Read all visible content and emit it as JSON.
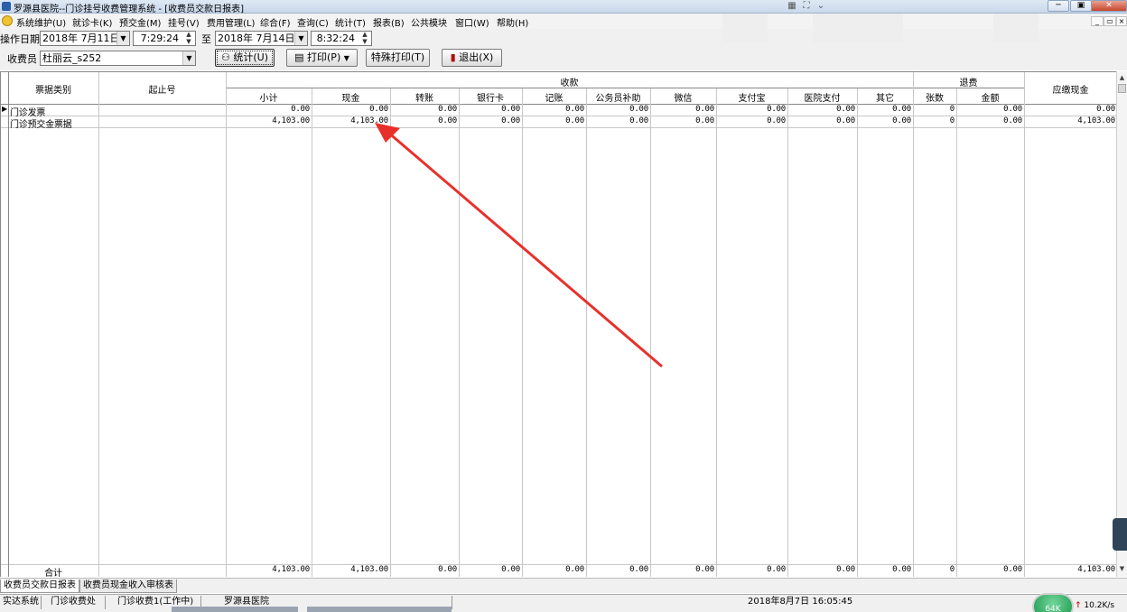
{
  "window": {
    "title": "罗源县医院--门诊挂号收费管理系统 - [收费员交款日报表]",
    "controls": {
      "minimize": "─",
      "restore": "▣",
      "close": "✕"
    }
  },
  "menu": {
    "items": [
      "系统维护(U)",
      "就诊卡(K)",
      "预交金(M)",
      "挂号(V)",
      "费用管理(L)",
      "综合(F)",
      "查询(C)",
      "统计(T)",
      "报表(B)",
      "公共模块",
      "窗口(W)",
      "帮助(H)"
    ],
    "mdi_controls": [
      "_",
      "▭",
      "×"
    ]
  },
  "filters": {
    "date_label": "操作日期",
    "start_date": "2018年 7月11日",
    "start_time": "7:29:24",
    "to_label": "至",
    "end_date": "2018年 7月14日",
    "end_time": "8:32:24",
    "cashier_label": "收费员",
    "cashier_value": "杜丽云_s252"
  },
  "buttons": {
    "stats": "统计(U)",
    "print": "打印(P)",
    "special_print": "特殊打印(T)",
    "exit": "退出(X)"
  },
  "table": {
    "headers": {
      "ticket_type": "票据类别",
      "range": "起止号",
      "income_group": "收款",
      "refund_group": "退费",
      "payable_cash": "应缴现金"
    },
    "income_columns": [
      "小计",
      "现金",
      "转账",
      "银行卡",
      "记账",
      "公务员补助",
      "微信",
      "支付宝",
      "医院支付",
      "其它"
    ],
    "refund_columns": [
      "张数",
      "金额"
    ],
    "rows": [
      {
        "type": "门诊发票",
        "range": "",
        "income": [
          "0.00",
          "0.00",
          "0.00",
          "0.00",
          "0.00",
          "0.00",
          "0.00",
          "0.00",
          "0.00",
          "0.00"
        ],
        "refund": [
          "0",
          "0.00"
        ],
        "payable": "0.00"
      },
      {
        "type": "门诊预交金票据",
        "range": "",
        "income": [
          "4,103.00",
          "4,103.00",
          "0.00",
          "0.00",
          "0.00",
          "0.00",
          "0.00",
          "0.00",
          "0.00",
          "0.00"
        ],
        "refund": [
          "0",
          "0.00"
        ],
        "payable": "4,103.00"
      }
    ],
    "total": {
      "label": "合计",
      "income": [
        "4,103.00",
        "4,103.00",
        "0.00",
        "0.00",
        "0.00",
        "0.00",
        "0.00",
        "0.00",
        "0.00",
        "0.00"
      ],
      "refund": [
        "0",
        "0.00"
      ],
      "payable": "4,103.00"
    }
  },
  "tabs": [
    "收费员交款日报表",
    "收费员现金收入审核表"
  ],
  "status": {
    "system": "实达系统",
    "dept": "门诊收费处",
    "station": "门诊收费1(工作中)",
    "hospital": "罗源县医院",
    "datetime": "2018年8月7日 16:05:45"
  },
  "tray": {
    "net_speed": "10.2K/s",
    "ball_label": "64K"
  },
  "colors": {
    "annotation_arrow": "#e8302b",
    "grid_line": "#c8c8c8"
  }
}
